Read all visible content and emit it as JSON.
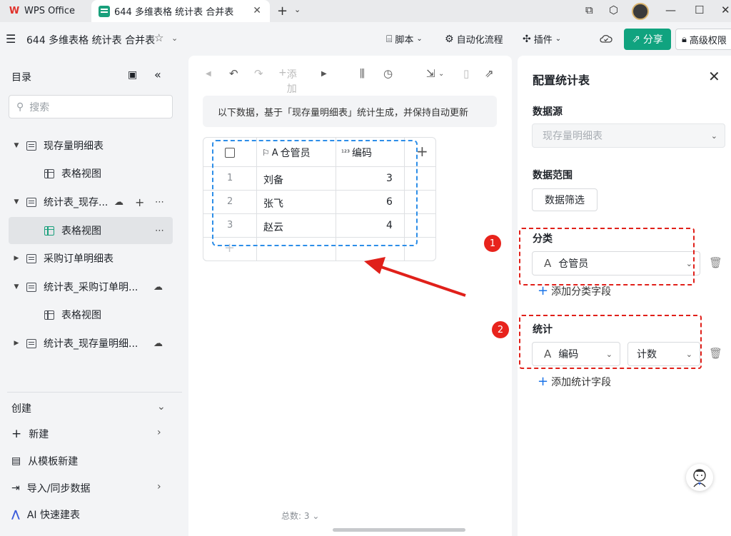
{
  "titlebar": {
    "app_tab": "WPS Office",
    "doc_tab": "644 多维表格 统计表 合并表"
  },
  "header": {
    "doc_title": "644 多维表格 统计表 合并表",
    "script_label": "脚本",
    "automation_label": "自动化流程",
    "plugin_label": "插件",
    "share_label": "分享",
    "permission_label": "高级权限"
  },
  "sidebar": {
    "title": "目录",
    "search_placeholder": "搜索",
    "items": [
      {
        "label": "现存量明细表"
      },
      {
        "label": "表格视图"
      },
      {
        "label": "统计表_现存..."
      },
      {
        "label": "表格视图"
      },
      {
        "label": "采购订单明细表"
      },
      {
        "label": "统计表_采购订单明..."
      },
      {
        "label": "表格视图"
      },
      {
        "label": "统计表_现存量明细..."
      }
    ],
    "create_section": "创建",
    "create_items": [
      {
        "label": "新建"
      },
      {
        "label": "从模板新建"
      },
      {
        "label": "导入/同步数据"
      },
      {
        "label": "AI 快速建表"
      }
    ]
  },
  "center": {
    "add_label": "添加",
    "notice": "以下数据，基于「现存量明细表」统计生成，并保持自动更新",
    "columns": [
      "仓管员",
      "编码"
    ],
    "rows": [
      {
        "index": "1",
        "name": "刘备",
        "code": "3"
      },
      {
        "index": "2",
        "name": "张飞",
        "code": "6"
      },
      {
        "index": "3",
        "name": "赵云",
        "code": "4"
      }
    ],
    "total_label": "总数: 3"
  },
  "config": {
    "title": "配置统计表",
    "datasource_label": "数据源",
    "datasource_value": "现存量明细表",
    "range_label": "数据范围",
    "filter_button": "数据筛选",
    "group_label": "分类",
    "group_field": "仓管员",
    "add_group": "添加分类字段",
    "stat_label": "统计",
    "stat_field": "编码",
    "stat_method": "计数",
    "add_stat": "添加统计字段",
    "marker_1": "1",
    "marker_2": "2"
  },
  "colors": {
    "accent_green": "#10a37f",
    "annotation_red": "#e0201a",
    "annotation_blue": "#2d8ee8"
  }
}
